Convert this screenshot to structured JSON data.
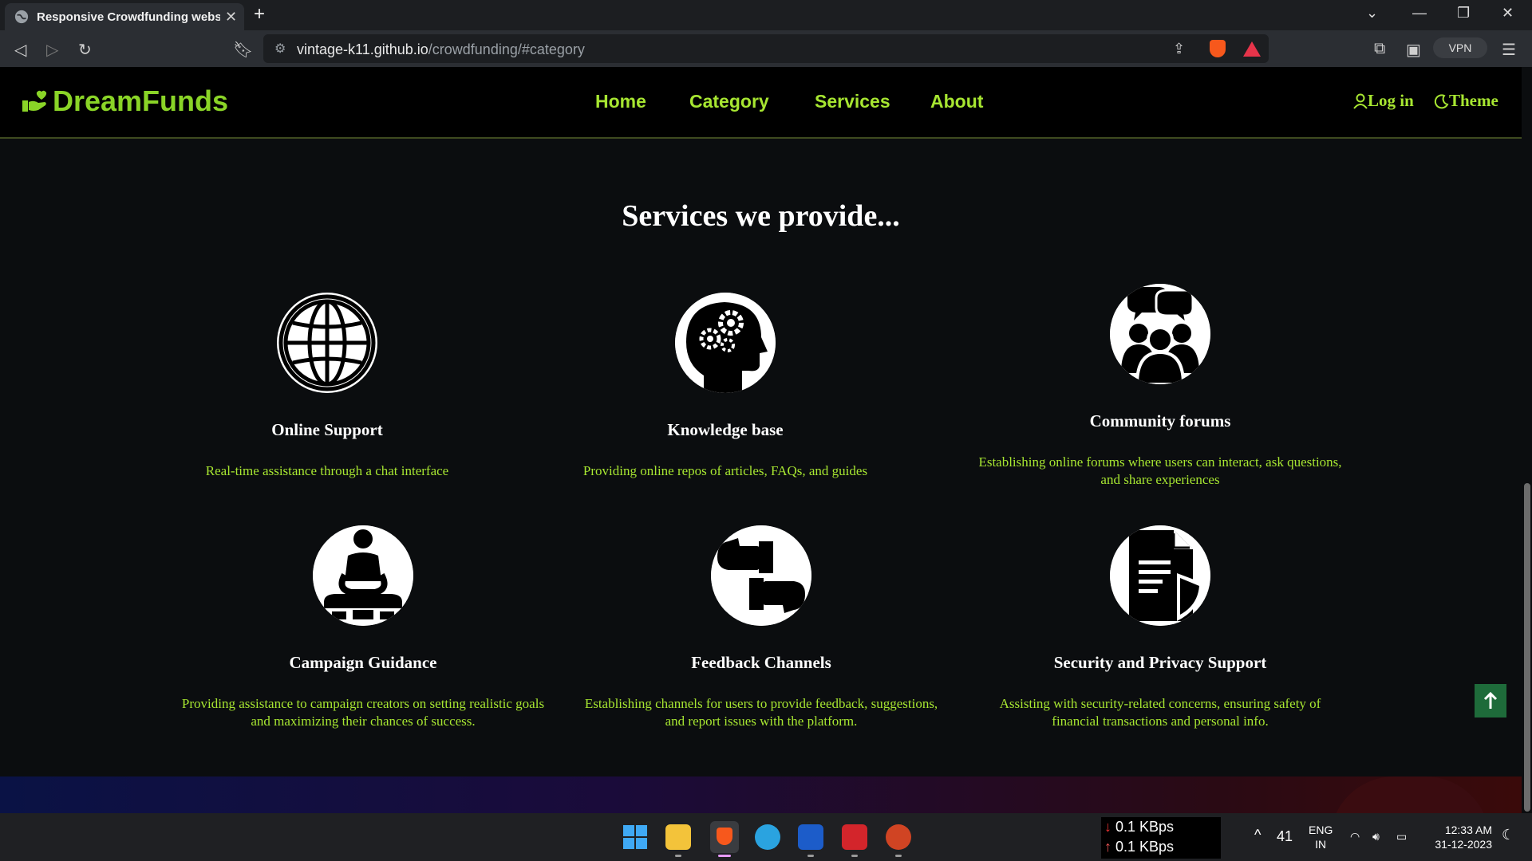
{
  "browser": {
    "tab_title": "Responsive Crowdfunding websi",
    "url_host": "vintage-k11.github.io",
    "url_path": "/crowdfunding/#category",
    "vpn_label": "VPN"
  },
  "site": {
    "brand": "DreamFunds",
    "nav": [
      "Home",
      "Category",
      "Services",
      "About"
    ],
    "login_label": "Log in",
    "theme_label": "Theme",
    "section_heading": "Services we provide...",
    "services": [
      {
        "icon": "globe-icon",
        "title": "Online Support",
        "desc": "Real-time assistance through a chat interface"
      },
      {
        "icon": "brain-gears-icon",
        "title": "Knowledge base",
        "desc": "Providing online repos of articles, FAQs, and guides"
      },
      {
        "icon": "community-chat-icon",
        "title": "Community forums",
        "desc": "Establishing online forums where users can interact, ask questions, and share experiences"
      },
      {
        "icon": "meditating-person-icon",
        "title": "Campaign Guidance",
        "desc": "Providing assistance to campaign creators on setting realistic goals and maximizing their chances of success."
      },
      {
        "icon": "thumbs-up-down-icon",
        "title": "Feedback Channels",
        "desc": "Establishing channels for users to provide feedback, suggestions, and report issues with the platform."
      },
      {
        "icon": "document-shield-icon",
        "title": "Security and Privacy Support",
        "desc": "Assisting with security-related concerns, ensuring safety of financial transactions and personal info."
      }
    ],
    "colors": {
      "accent": "#a7e631",
      "brand": "#8ad427",
      "background": "#0b0d0f"
    }
  },
  "taskbar": {
    "net_down": "0.1 KBps",
    "net_up": "0.1 KBps",
    "temp": "41",
    "lang_1": "ENG",
    "lang_2": "IN",
    "time": "12:33 AM",
    "date": "31-12-2023"
  }
}
